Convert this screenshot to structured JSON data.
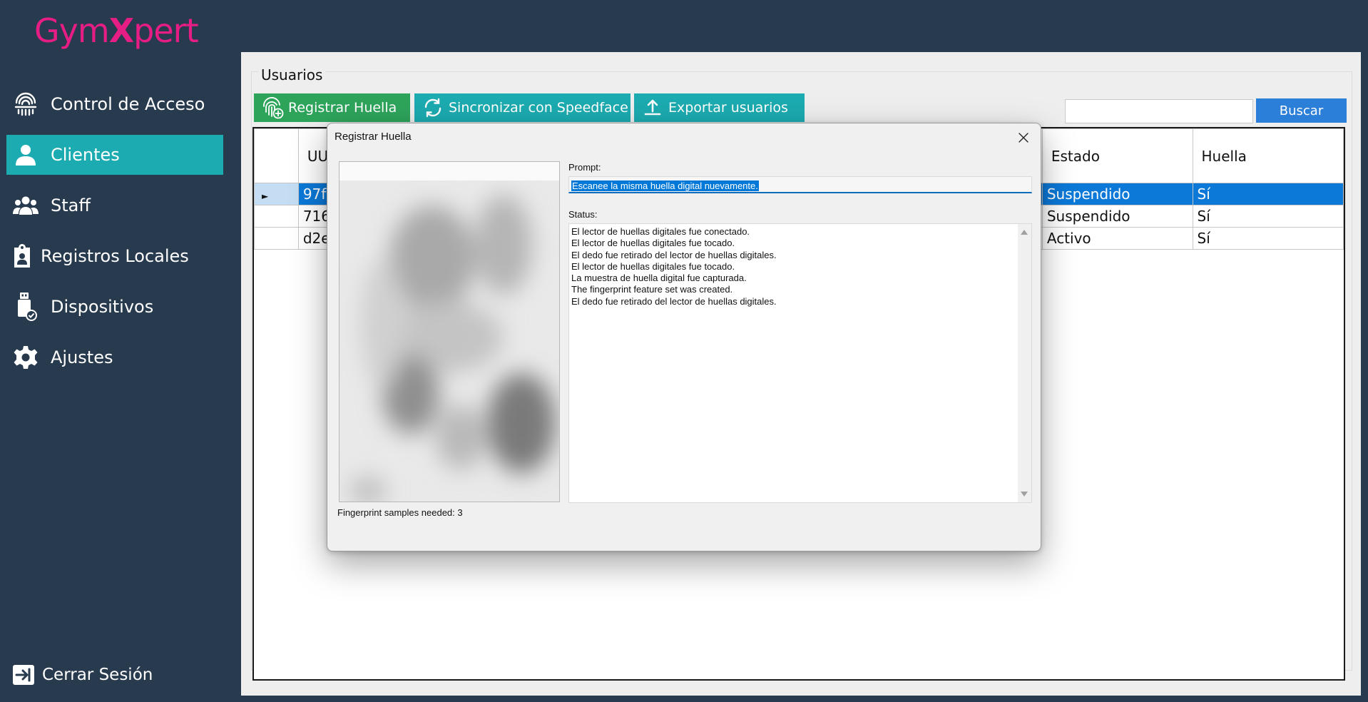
{
  "app": {
    "logo_text_pre": "Gym",
    "logo_text_x": "X",
    "logo_text_post": "pert",
    "brand_color": "#e61d84",
    "accent_color": "#1cabb0"
  },
  "sidebar": {
    "items": [
      {
        "label": "Control de Acceso",
        "icon": "fingerprint-icon",
        "active": false
      },
      {
        "label": "Clientes",
        "icon": "user-icon",
        "active": true
      },
      {
        "label": "Staff",
        "icon": "users-group-icon",
        "active": false
      },
      {
        "label": "Registros Locales",
        "icon": "clipboard-user-icon",
        "active": false
      },
      {
        "label": "Dispositivos",
        "icon": "usb-device-icon",
        "active": false
      },
      {
        "label": "Ajustes",
        "icon": "gear-icon",
        "active": false
      }
    ],
    "logout_label": "Cerrar Sesión"
  },
  "main": {
    "group_title": "Usuarios",
    "toolbar": {
      "register_label": "Registrar Huella",
      "sync_label": "Sincronizar con Speedface",
      "export_label": "Exportar usuarios"
    },
    "search": {
      "value": "",
      "button_label": "Buscar"
    },
    "table": {
      "columns": [
        "UU",
        "Estado",
        "Huella"
      ],
      "rows": [
        {
          "uu": "97f",
          "estado": "Suspendido",
          "huella": "Sí",
          "selected": true
        },
        {
          "uu": "716",
          "estado": "Suspendido",
          "huella": "Sí",
          "selected": false
        },
        {
          "uu": "d2e",
          "estado": "Activo",
          "huella": "Sí",
          "selected": false
        }
      ]
    }
  },
  "dialog": {
    "title": "Registrar Huella",
    "prompt_label": "Prompt:",
    "prompt_value": "Escanee la misma huella digital nuevamente.",
    "status_label": "Status:",
    "status_lines": [
      "El lector de huellas digitales fue conectado.",
      "El lector de huellas digitales fue tocado.",
      "El dedo fue retirado del lector de huellas digitales.",
      "El lector de huellas digitales fue tocado.",
      "La muestra de huella digital fue capturada.",
      "The fingerprint feature set was created.",
      "El dedo fue retirado del lector de huellas digitales."
    ],
    "samples_needed": "Fingerprint samples needed: 3"
  }
}
